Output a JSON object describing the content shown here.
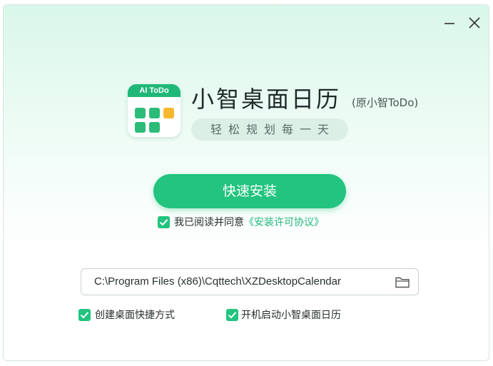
{
  "window": {
    "controls": {
      "minimize_icon": "minimize-icon",
      "close_icon": "close-icon"
    }
  },
  "logo": {
    "badge_text": "AI ToDo",
    "icon": "calendar-grid-icon",
    "accent": "#F5B82E",
    "brand": "#22C47F"
  },
  "app": {
    "title": "小智桌面日历",
    "subtitle": "(原小智ToDo)",
    "tagline": "轻松规划每一天"
  },
  "install": {
    "label": "快速安装"
  },
  "agreement": {
    "checked": true,
    "prefix": "我已阅读并同意",
    "link_text": "《安装许可协议》"
  },
  "path": {
    "value": "C:\\Program Files (x86)\\Cqttech\\XZDesktopCalendar",
    "icon": "folder-icon"
  },
  "options": [
    {
      "label": "创建桌面快捷方式",
      "checked": true
    },
    {
      "label": "开机启动小智桌面日历",
      "checked": true
    }
  ]
}
